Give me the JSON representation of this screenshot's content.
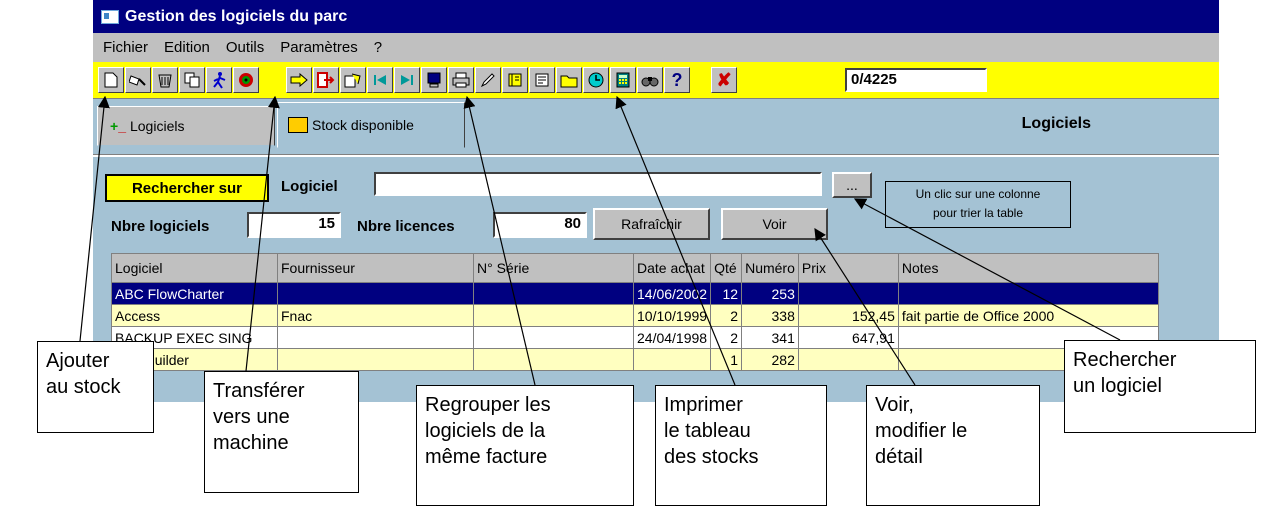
{
  "window": {
    "title": "Gestion des logiciels du parc"
  },
  "menu": [
    "Fichier",
    "Edition",
    "Outils",
    "Paramètres",
    "?"
  ],
  "toolbar": {
    "counter": "0/4225",
    "icons": [
      "new-document-icon",
      "gavel-icon",
      "trash-icon",
      "copy-icon",
      "running-man-icon",
      "target-icon",
      "arrow-right-icon",
      "exit-icon",
      "group-icon",
      "first-record-icon",
      "last-record-icon",
      "monitor-icon",
      "printer-icon",
      "pen-icon",
      "book-icon",
      "notepad-icon",
      "folder-icon",
      "clock-icon",
      "calculator-icon",
      "binoculars-icon",
      "help-icon",
      "cancel-icon"
    ]
  },
  "tabs": [
    {
      "label": "Logiciels"
    },
    {
      "label": "Stock disponible"
    }
  ],
  "page_title": "Logiciels",
  "search": {
    "button": "Rechercher sur",
    "field_label": "Logiciel",
    "value": "",
    "browse": "..."
  },
  "counts": {
    "nb_logiciels_label": "Nbre logiciels",
    "nb_logiciels": "15",
    "nb_licences_label": "Nbre licences",
    "nb_licences": "80"
  },
  "buttons": {
    "refresh": "Rafraîchir",
    "view": "Voir"
  },
  "hint": {
    "line1": "Un clic sur une colonne",
    "line2": "pour trier la table"
  },
  "table": {
    "headers": [
      "Logiciel",
      "Fournisseur",
      "N° Série",
      "Date achat",
      "Qté",
      "Numéro",
      "Prix",
      "Notes"
    ],
    "rows": [
      [
        "ABC FlowCharter",
        "",
        "",
        "14/06/2002",
        "12",
        "253",
        "",
        ""
      ],
      [
        "Access",
        "Fnac",
        "",
        "10/10/1999",
        "2",
        "338",
        "152,45",
        "fait partie de Office 2000"
      ],
      [
        "BACKUP EXEC SING",
        "",
        "",
        "24/04/1998",
        "2",
        "341",
        "647,91",
        ""
      ],
      [
        "C++ Builder",
        "",
        "",
        "",
        "1",
        "282",
        "",
        ""
      ]
    ]
  },
  "callouts": {
    "ajouter": [
      "Ajouter",
      "au stock"
    ],
    "transferer": [
      "Transférer",
      "vers une",
      "machine"
    ],
    "regrouper": [
      "Regrouper les",
      "logiciels de la",
      "même facture"
    ],
    "imprimer": [
      "Imprimer",
      "le tableau",
      "des stocks"
    ],
    "voir": [
      "Voir,",
      "modifier le",
      "détail"
    ],
    "rechercher": [
      "Rechercher",
      "un logiciel"
    ]
  }
}
